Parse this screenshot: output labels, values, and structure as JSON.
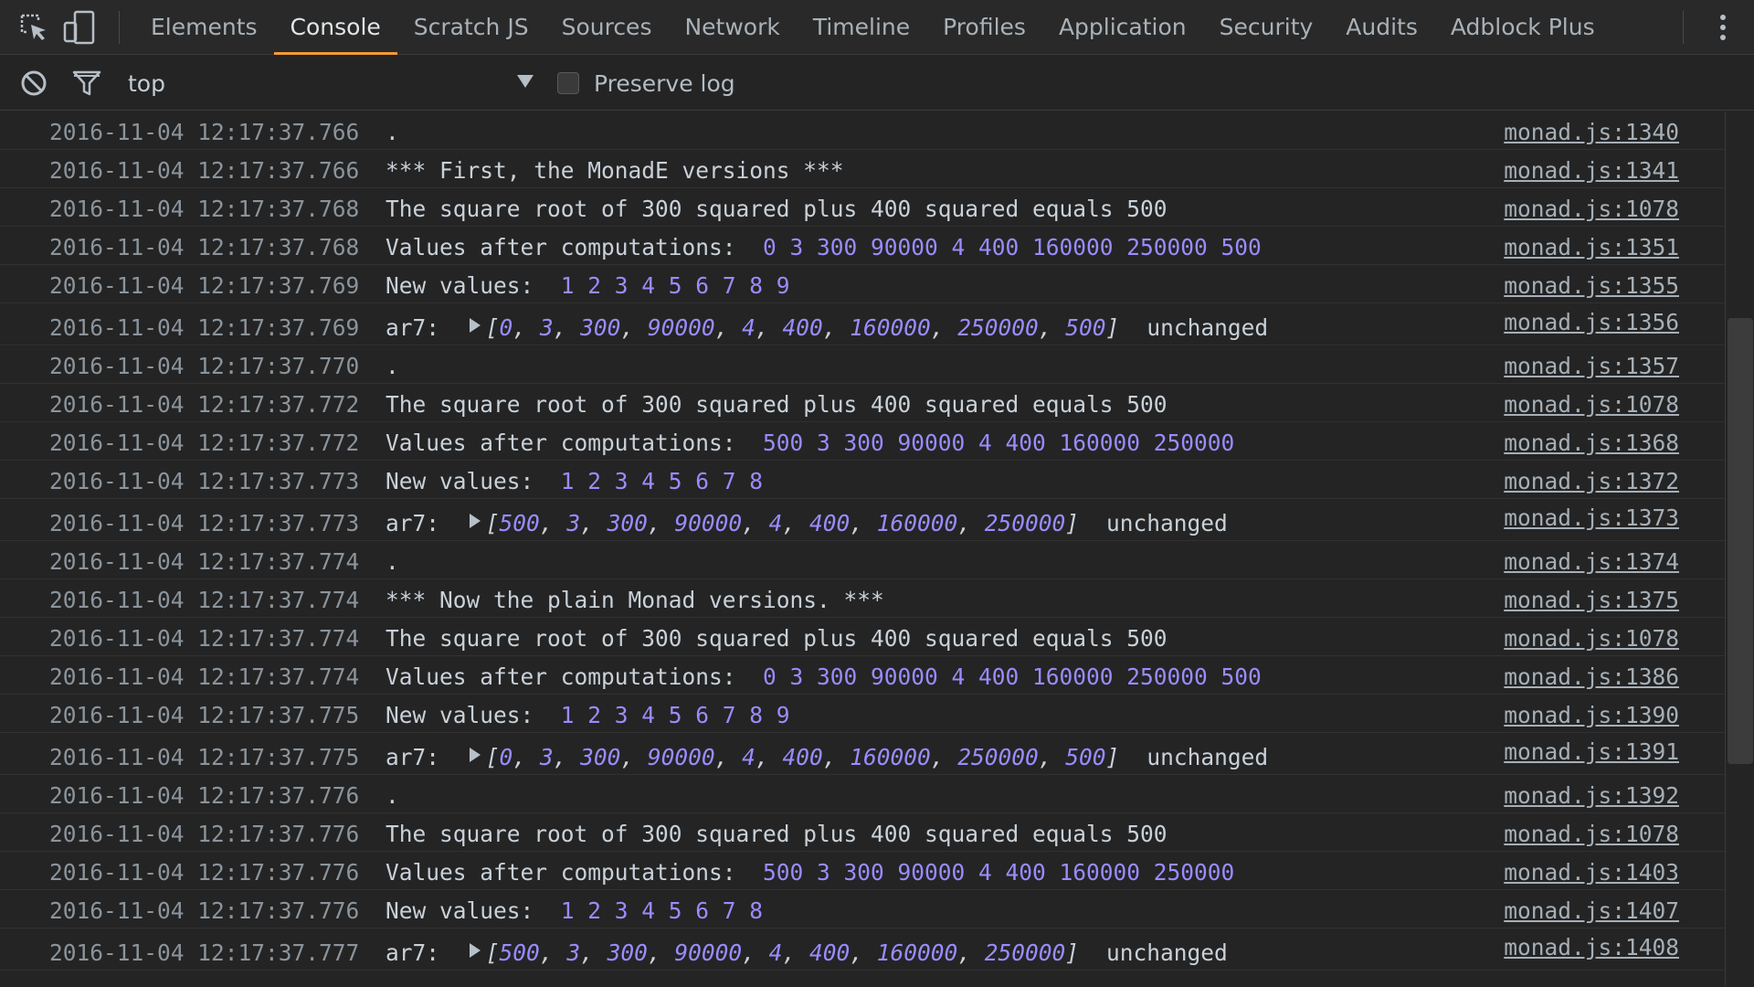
{
  "tabs": [
    {
      "label": "Elements"
    },
    {
      "label": "Console"
    },
    {
      "label": "Scratch JS"
    },
    {
      "label": "Sources"
    },
    {
      "label": "Network"
    },
    {
      "label": "Timeline"
    },
    {
      "label": "Profiles"
    },
    {
      "label": "Application"
    },
    {
      "label": "Security"
    },
    {
      "label": "Audits"
    },
    {
      "label": "Adblock Plus"
    }
  ],
  "active_tab": "Console",
  "icons": {
    "inspect": "inspect-element-icon",
    "device": "device-toolbar-icon",
    "more": "more-options-icon",
    "clear": "clear-console-icon",
    "filter": "filter-icon",
    "dropdown": "dropdown-arrow-icon",
    "expand": "expand-triangle-icon"
  },
  "toolbar": {
    "context": "top",
    "preserve_log_label": "Preserve log",
    "preserve_log_checked": false
  },
  "colors": {
    "background": "#242424",
    "accent_tab": "#f29a38",
    "number": "#9a8cff",
    "text": "#c9d1d9"
  },
  "log": [
    {
      "ts": "2016-11-04 12:17:37.766",
      "type": "text",
      "text": ".",
      "src": "monad.js:1340"
    },
    {
      "ts": "2016-11-04 12:17:37.766",
      "type": "text",
      "text": "*** First, the MonadE versions ***",
      "src": "monad.js:1341"
    },
    {
      "ts": "2016-11-04 12:17:37.768",
      "type": "text",
      "text": "The square root of 300 squared plus 400 squared equals 500",
      "src": "monad.js:1078"
    },
    {
      "ts": "2016-11-04 12:17:37.768",
      "type": "values",
      "label": "Values after computations: ",
      "values": "0 3 300 90000 4 400 160000 250000 500",
      "src": "monad.js:1351"
    },
    {
      "ts": "2016-11-04 12:17:37.769",
      "type": "values",
      "label": "New values: ",
      "values": "1 2 3 4 5 6 7 8 9",
      "src": "monad.js:1355"
    },
    {
      "ts": "2016-11-04 12:17:37.769",
      "type": "array",
      "label": "ar7: ",
      "items": [
        "0",
        "3",
        "300",
        "90000",
        "4",
        "400",
        "160000",
        "250000",
        "500"
      ],
      "suffix": "unchanged",
      "src": "monad.js:1356"
    },
    {
      "ts": "2016-11-04 12:17:37.770",
      "type": "text",
      "text": ".",
      "src": "monad.js:1357"
    },
    {
      "ts": "2016-11-04 12:17:37.772",
      "type": "text",
      "text": "The square root of 300 squared plus 400 squared equals 500",
      "src": "monad.js:1078"
    },
    {
      "ts": "2016-11-04 12:17:37.772",
      "type": "values",
      "label": "Values after computations: ",
      "values": "500 3 300 90000 4 400 160000 250000",
      "src": "monad.js:1368"
    },
    {
      "ts": "2016-11-04 12:17:37.773",
      "type": "values",
      "label": "New values: ",
      "values": "1 2 3 4 5 6 7 8",
      "src": "monad.js:1372"
    },
    {
      "ts": "2016-11-04 12:17:37.773",
      "type": "array",
      "label": "ar7: ",
      "items": [
        "500",
        "3",
        "300",
        "90000",
        "4",
        "400",
        "160000",
        "250000"
      ],
      "suffix": "unchanged",
      "src": "monad.js:1373"
    },
    {
      "ts": "2016-11-04 12:17:37.774",
      "type": "text",
      "text": ".",
      "src": "monad.js:1374"
    },
    {
      "ts": "2016-11-04 12:17:37.774",
      "type": "text",
      "text": "*** Now the plain Monad versions. ***",
      "src": "monad.js:1375"
    },
    {
      "ts": "2016-11-04 12:17:37.774",
      "type": "text",
      "text": "The square root of 300 squared plus 400 squared equals 500",
      "src": "monad.js:1078"
    },
    {
      "ts": "2016-11-04 12:17:37.774",
      "type": "values",
      "label": "Values after computations: ",
      "values": "0 3 300 90000 4 400 160000 250000 500",
      "src": "monad.js:1386"
    },
    {
      "ts": "2016-11-04 12:17:37.775",
      "type": "values",
      "label": "New values: ",
      "values": "1 2 3 4 5 6 7 8 9",
      "src": "monad.js:1390"
    },
    {
      "ts": "2016-11-04 12:17:37.775",
      "type": "array",
      "label": "ar7: ",
      "items": [
        "0",
        "3",
        "300",
        "90000",
        "4",
        "400",
        "160000",
        "250000",
        "500"
      ],
      "suffix": "unchanged",
      "src": "monad.js:1391"
    },
    {
      "ts": "2016-11-04 12:17:37.776",
      "type": "text",
      "text": ".",
      "src": "monad.js:1392"
    },
    {
      "ts": "2016-11-04 12:17:37.776",
      "type": "text",
      "text": "The square root of 300 squared plus 400 squared equals 500",
      "src": "monad.js:1078"
    },
    {
      "ts": "2016-11-04 12:17:37.776",
      "type": "values",
      "label": "Values after computations: ",
      "values": "500 3 300 90000 4 400 160000 250000",
      "src": "monad.js:1403"
    },
    {
      "ts": "2016-11-04 12:17:37.776",
      "type": "values",
      "label": "New values: ",
      "values": "1 2 3 4 5 6 7 8",
      "src": "monad.js:1407"
    },
    {
      "ts": "2016-11-04 12:17:37.777",
      "type": "array",
      "label": "ar7: ",
      "items": [
        "500",
        "3",
        "300",
        "90000",
        "4",
        "400",
        "160000",
        "250000"
      ],
      "suffix": "unchanged",
      "src": "monad.js:1408"
    }
  ]
}
